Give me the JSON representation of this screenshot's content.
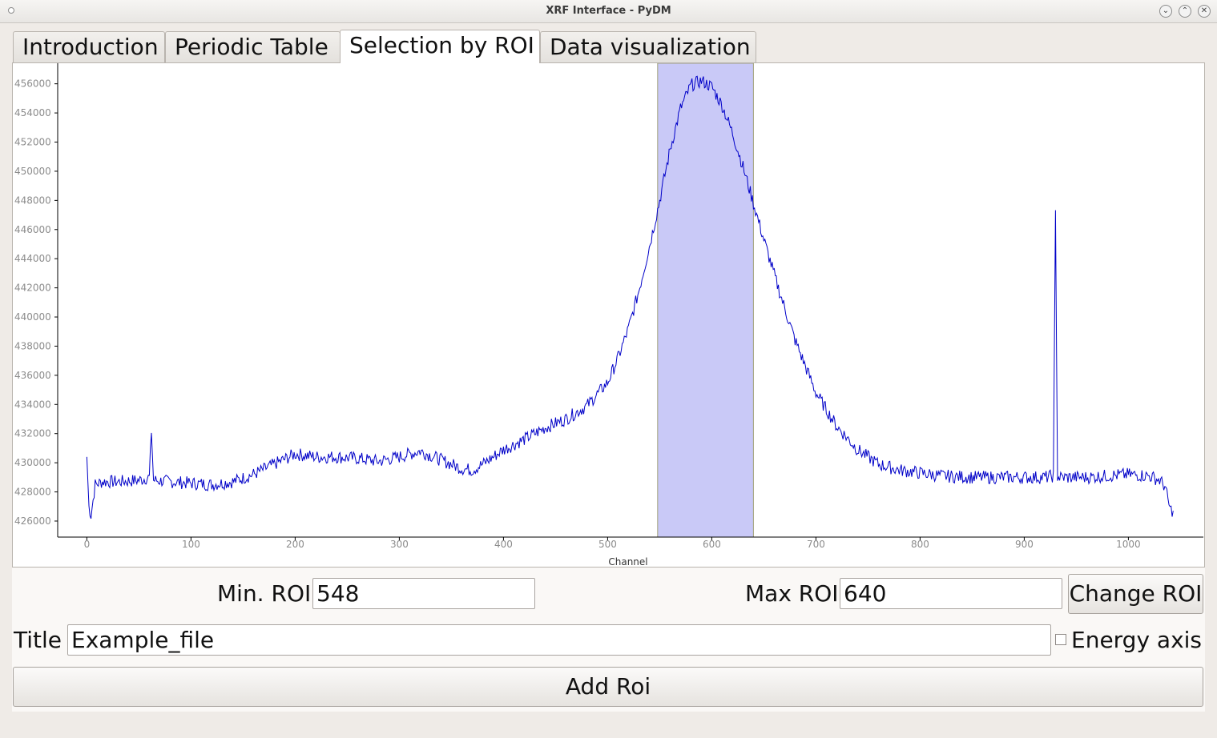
{
  "window": {
    "title": "XRF Interface - PyDM"
  },
  "tabs": [
    {
      "label": "Introduction"
    },
    {
      "label": "Periodic Table"
    },
    {
      "label": "Selection by ROI"
    },
    {
      "label": "Data visualization"
    }
  ],
  "active_tab": "Selection by ROI",
  "controls": {
    "min_roi_label": "Min. ROI",
    "min_roi_value": "548",
    "max_roi_label": "Max ROI",
    "max_roi_value": "640",
    "change_roi_button": "Change ROI",
    "title_label": "Title",
    "title_value": "Example_file",
    "energy_axis_label": "Energy axis",
    "energy_axis_checked": false,
    "add_roi_button": "Add Roi"
  },
  "colors": {
    "curve": "#0000c8",
    "roi_fill": "#c9c9f7",
    "roi_border": "#a0a07a",
    "tick_text": "#8c8c8c"
  },
  "chart_data": {
    "type": "line",
    "xlabel": "Channel",
    "ylabel": "",
    "xlim": [
      -28,
      1072
    ],
    "ylim": [
      424900,
      457300
    ],
    "x_ticks": [
      0,
      100,
      200,
      300,
      400,
      500,
      600,
      700,
      800,
      900,
      1000
    ],
    "y_ticks": [
      426000,
      428000,
      430000,
      432000,
      434000,
      436000,
      438000,
      440000,
      442000,
      444000,
      446000,
      448000,
      450000,
      452000,
      454000,
      456000
    ],
    "roi_region": [
      548,
      640
    ],
    "series": [
      {
        "x": [
          0,
          2,
          4,
          8,
          15,
          30,
          50,
          60,
          62,
          64,
          80,
          100,
          120,
          140,
          160,
          180,
          200,
          220,
          240,
          260,
          280,
          300,
          320,
          340,
          360,
          370,
          380,
          400,
          420,
          440,
          460,
          480,
          500,
          510,
          520,
          530,
          540,
          550,
          560,
          570,
          580,
          590,
          600,
          610,
          620,
          630,
          640,
          650,
          660,
          670,
          680,
          700,
          720,
          740,
          760,
          780,
          800,
          820,
          850,
          880,
          900,
          920,
          928,
          930,
          932,
          940,
          960,
          980,
          1000,
          1020,
          1030,
          1035,
          1040,
          1043
        ],
        "values": [
          430400,
          427000,
          426400,
          428500,
          428700,
          428700,
          428800,
          429000,
          432200,
          428800,
          428700,
          428600,
          428500,
          428700,
          429200,
          429900,
          430600,
          430400,
          430400,
          430300,
          430100,
          430400,
          430800,
          430200,
          429600,
          429500,
          429900,
          430900,
          431600,
          432400,
          433000,
          433900,
          435500,
          437200,
          439200,
          441800,
          444800,
          448000,
          451500,
          454300,
          455900,
          456200,
          455800,
          454500,
          452600,
          450300,
          447800,
          445300,
          442900,
          440600,
          438400,
          434800,
          432500,
          430900,
          429900,
          429500,
          429300,
          429100,
          429000,
          429000,
          429000,
          429000,
          429100,
          447100,
          429000,
          429000,
          429000,
          429100,
          429200,
          429100,
          428800,
          428400,
          426800,
          426700
        ]
      }
    ]
  }
}
